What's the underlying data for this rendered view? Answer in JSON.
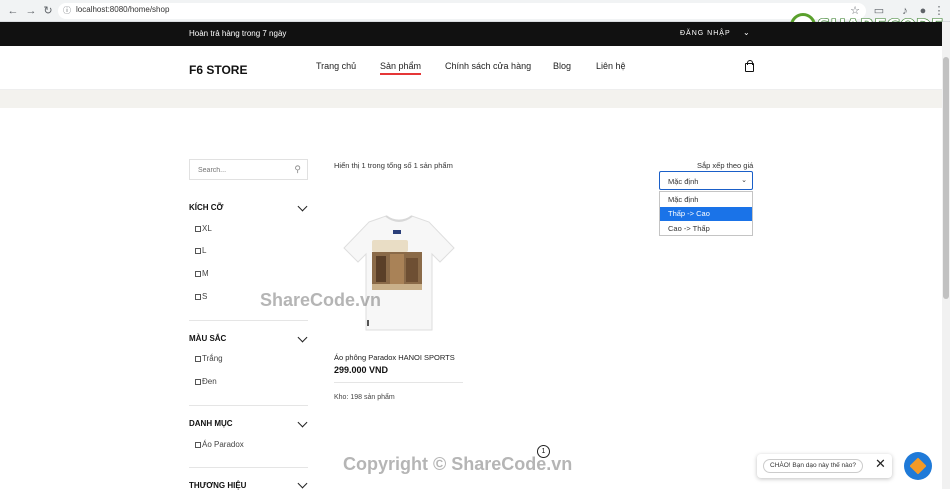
{
  "browser": {
    "url": "localhost:8080/home/shop",
    "icons": [
      "back-icon",
      "forward-icon",
      "reload-icon",
      "star-icon",
      "extension-icon",
      "music-icon",
      "profile-icon",
      "menu-icon"
    ]
  },
  "topbar": {
    "promo": "Hoàn trả hàng trong 7 ngày",
    "login": "ĐĂNG NHẬP"
  },
  "header": {
    "brand": "F6 STORE",
    "menu": [
      "Trang chủ",
      "Sản phẩm",
      "Chính sách cửa hàng",
      "Blog",
      "Liên hệ"
    ],
    "active_menu": "Sản phẩm",
    "accent_color": "#e53637"
  },
  "sidebar": {
    "search_placeholder": "Search...",
    "size": {
      "title": "KÍCH CỠ",
      "options": [
        "XL",
        "L",
        "M",
        "S"
      ]
    },
    "color": {
      "title": "MÀU SẮC",
      "options": [
        "Trắng",
        "Đen"
      ]
    },
    "category": {
      "title": "DANH MỤC",
      "options": [
        "Áo Paradox"
      ]
    },
    "brand": {
      "title": "THƯƠNG HIỆU"
    }
  },
  "main": {
    "showing": "Hiển thị 1 trong tổng số 1 sản phẩm",
    "sort_label": "Sắp xếp theo giá",
    "sort_value": "Mặc định",
    "sort_options": [
      "Mặc định",
      "Thấp -> Cao",
      "Cao -> Thấp"
    ],
    "sort_highlighted": "Thấp -> Cao",
    "product": {
      "name": "Áo phông Paradox HANOI SPORTS",
      "price": "299.000 VND",
      "stock": "Kho: 198 sản phẩm"
    },
    "page": "1"
  },
  "watermarks": {
    "center": "ShareCode.vn",
    "bottom": "Copyright © ShareCode.vn",
    "logo": "SHARECODE.vn"
  },
  "chat": {
    "greeting": "CHÀO! Bạn dạo này thế nào?"
  }
}
